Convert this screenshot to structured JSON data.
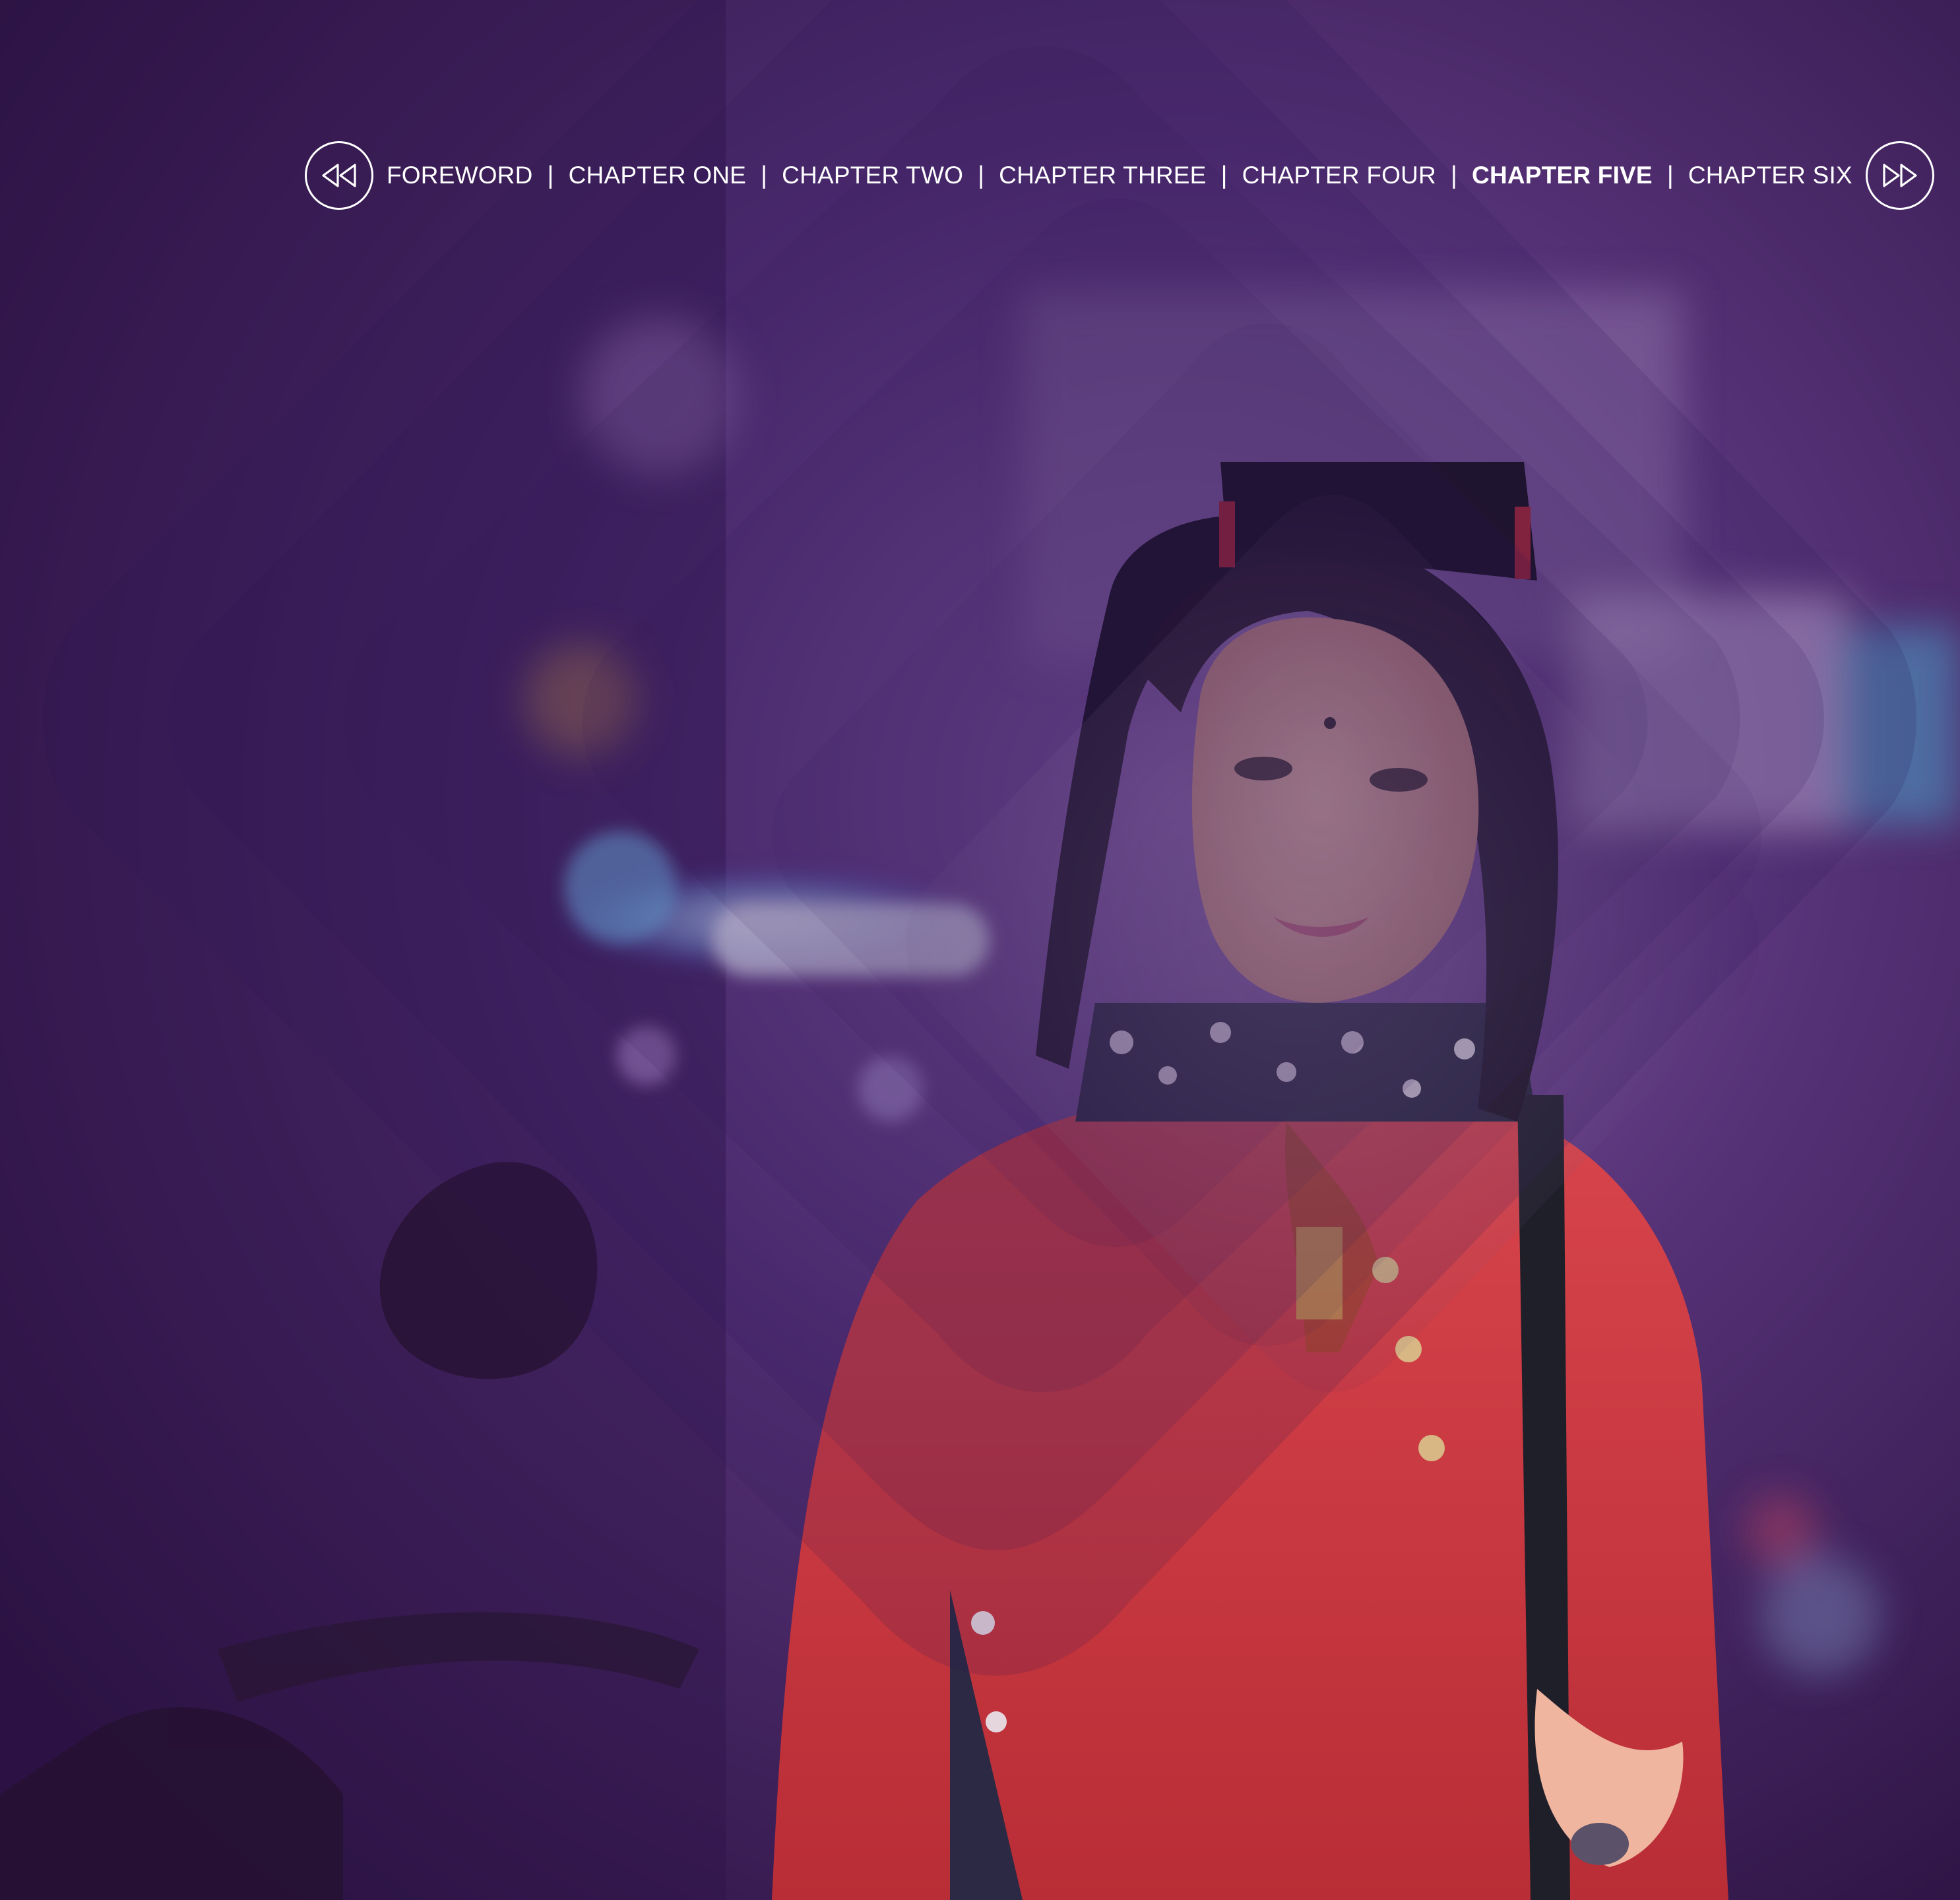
{
  "nav": {
    "prev_icon": "rewind-icon",
    "next_icon": "fast-forward-icon",
    "items": [
      {
        "label": "FOREWORD",
        "active": false
      },
      {
        "label": "CHAPTER ONE",
        "active": false
      },
      {
        "label": "CHAPTER TWO",
        "active": false
      },
      {
        "label": "CHAPTER THREE",
        "active": false
      },
      {
        "label": "CHAPTER FOUR",
        "active": false
      },
      {
        "label": "CHAPTER FIVE",
        "active": true
      },
      {
        "label": "CHAPTER SIX",
        "active": false
      }
    ],
    "separator": "|"
  },
  "colors": {
    "nav_text": "#ffffff",
    "overlay_purple": "#3b1a63",
    "shirt_red": "#c7343a"
  }
}
